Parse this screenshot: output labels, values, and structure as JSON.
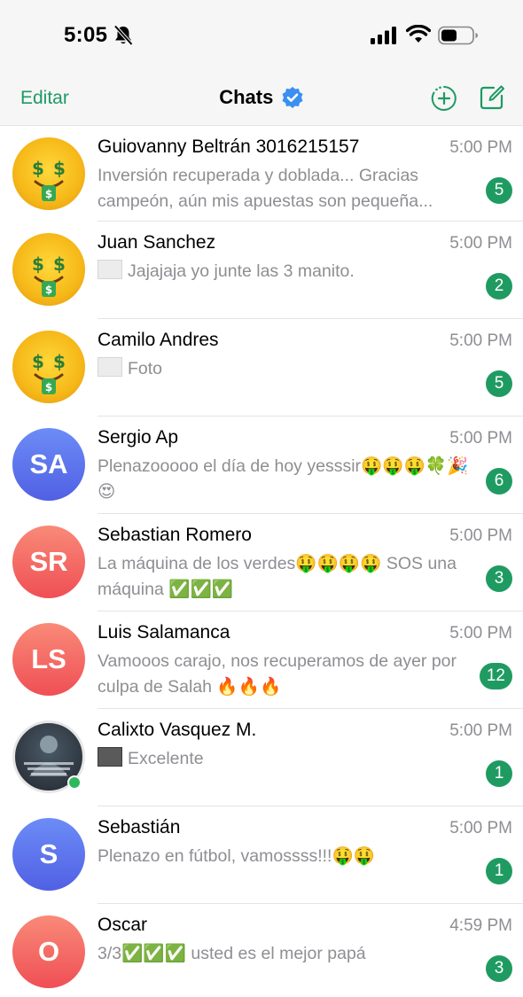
{
  "status_bar": {
    "time": "5:05",
    "icons": [
      "bell-slash-icon",
      "cellular-signal-icon",
      "wifi-icon",
      "battery-icon"
    ]
  },
  "nav": {
    "edit_label": "Editar",
    "title": "Chats",
    "icons": [
      "verified-badge-icon",
      "new-status-icon",
      "compose-icon"
    ]
  },
  "colors": {
    "accent": "#1e9a63",
    "badge": "#1f9b62",
    "secondary_text": "#8e8e93",
    "online": "#2eb85c"
  },
  "chats": [
    {
      "name": "Guiovanny Beltrán 3016215157",
      "time": "5:00 PM",
      "preview": "Inversión recuperada y doblada... Gracias campeón, aún mis apuestas son pequeña...",
      "unread": "5",
      "avatar": "money-face-photo"
    },
    {
      "name": "Juan Sanchez",
      "time": "5:00 PM",
      "preview": "Jajajaja yo junte las 3 manito.",
      "unread": "2",
      "avatar": "money-face-photo"
    },
    {
      "name": "Camilo Andres",
      "time": "5:00 PM",
      "preview": "Foto",
      "unread": "5",
      "avatar": "money-face-photo"
    },
    {
      "name": "Sergio Ap",
      "time": "5:00 PM",
      "preview": "Plenazooooo el día de hoy yesssir🤑🤑🤑🍀🎉😍",
      "unread": "6",
      "initials": "SA"
    },
    {
      "name": "Sebastian Romero",
      "time": "5:00 PM",
      "preview": "La máquina de los verdes🤑🤑🤑🤑 SOS una máquina ✅✅✅",
      "unread": "3",
      "initials": "SR"
    },
    {
      "name": "Luis Salamanca",
      "time": "5:00 PM",
      "preview": "Vamooos carajo, nos recuperamos de ayer por culpa de Salah 🔥🔥🔥",
      "unread": "12",
      "initials": "LS"
    },
    {
      "name": "Calixto Vasquez M.",
      "time": "5:00 PM",
      "preview": "Excelente",
      "unread": "1",
      "avatar": "profile-photo"
    },
    {
      "name": "Sebastián",
      "time": "5:00 PM",
      "preview": "Plenazo en fútbol, vamossss!!!🤑🤑",
      "unread": "1",
      "initials": "S"
    },
    {
      "name": "Oscar",
      "time": "4:59 PM",
      "preview": "3/3✅✅✅ usted es el mejor papá",
      "unread": "3",
      "initials": "O"
    }
  ]
}
